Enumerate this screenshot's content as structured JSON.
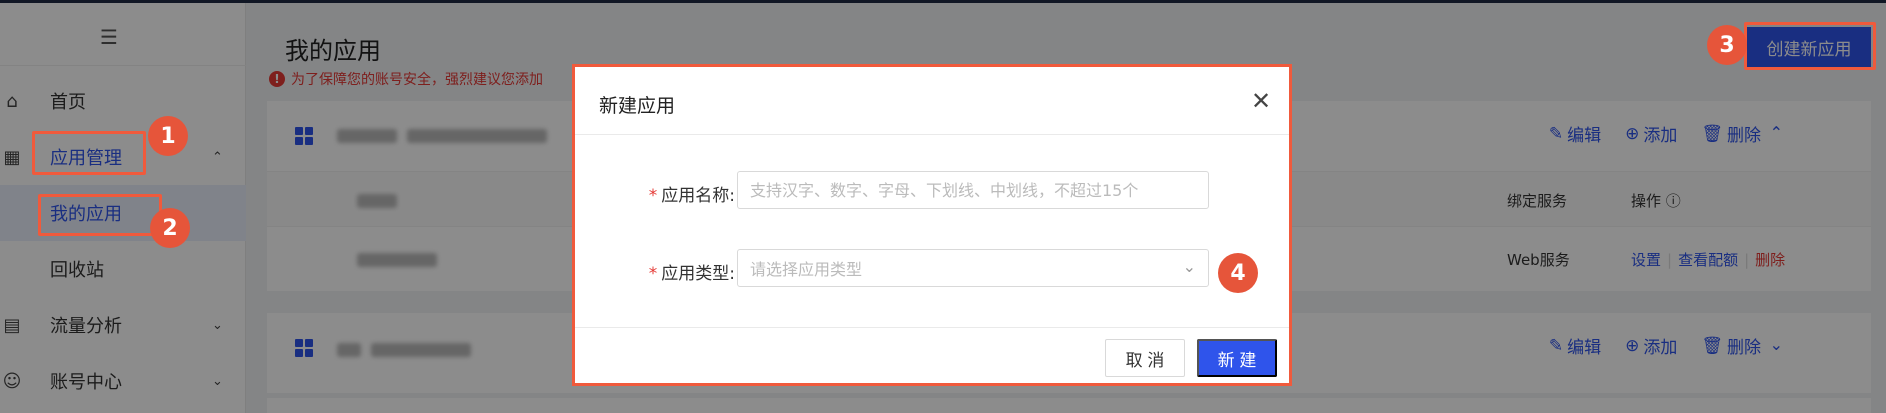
{
  "sidebar": {
    "items": [
      {
        "label": "首页",
        "icon": "home-icon"
      },
      {
        "label": "应用管理",
        "icon": "grid-icon"
      },
      {
        "label": "流量分析",
        "icon": "chart-icon"
      },
      {
        "label": "账号中心",
        "icon": "user-icon"
      }
    ],
    "sub_items": [
      {
        "label": "我的应用"
      },
      {
        "label": "回收站"
      }
    ]
  },
  "main": {
    "title": "我的应用",
    "warning": "为了保障您的账号安全，强烈建议您添加",
    "create_button": "创建新应用",
    "card_actions": {
      "edit": "编辑",
      "add": "添加",
      "delete": "删除"
    },
    "table_headers": {
      "service": "绑定服务",
      "ops": "操作"
    },
    "row": {
      "service": "Web服务",
      "settings": "设置",
      "quota": "查看配额",
      "delete": "删除"
    }
  },
  "dialog": {
    "title": "新建应用",
    "name_label": "应用名称:",
    "name_placeholder": "支持汉字、数字、字母、下划线、中划线，不超过15个",
    "type_label": "应用类型:",
    "type_placeholder": "请选择应用类型",
    "cancel": "取 消",
    "confirm": "新 建"
  },
  "annotations": [
    "1",
    "2",
    "3",
    "4"
  ],
  "colors": {
    "accent": "#2f54eb",
    "highlight": "#f05a3c",
    "danger": "#e53935"
  }
}
